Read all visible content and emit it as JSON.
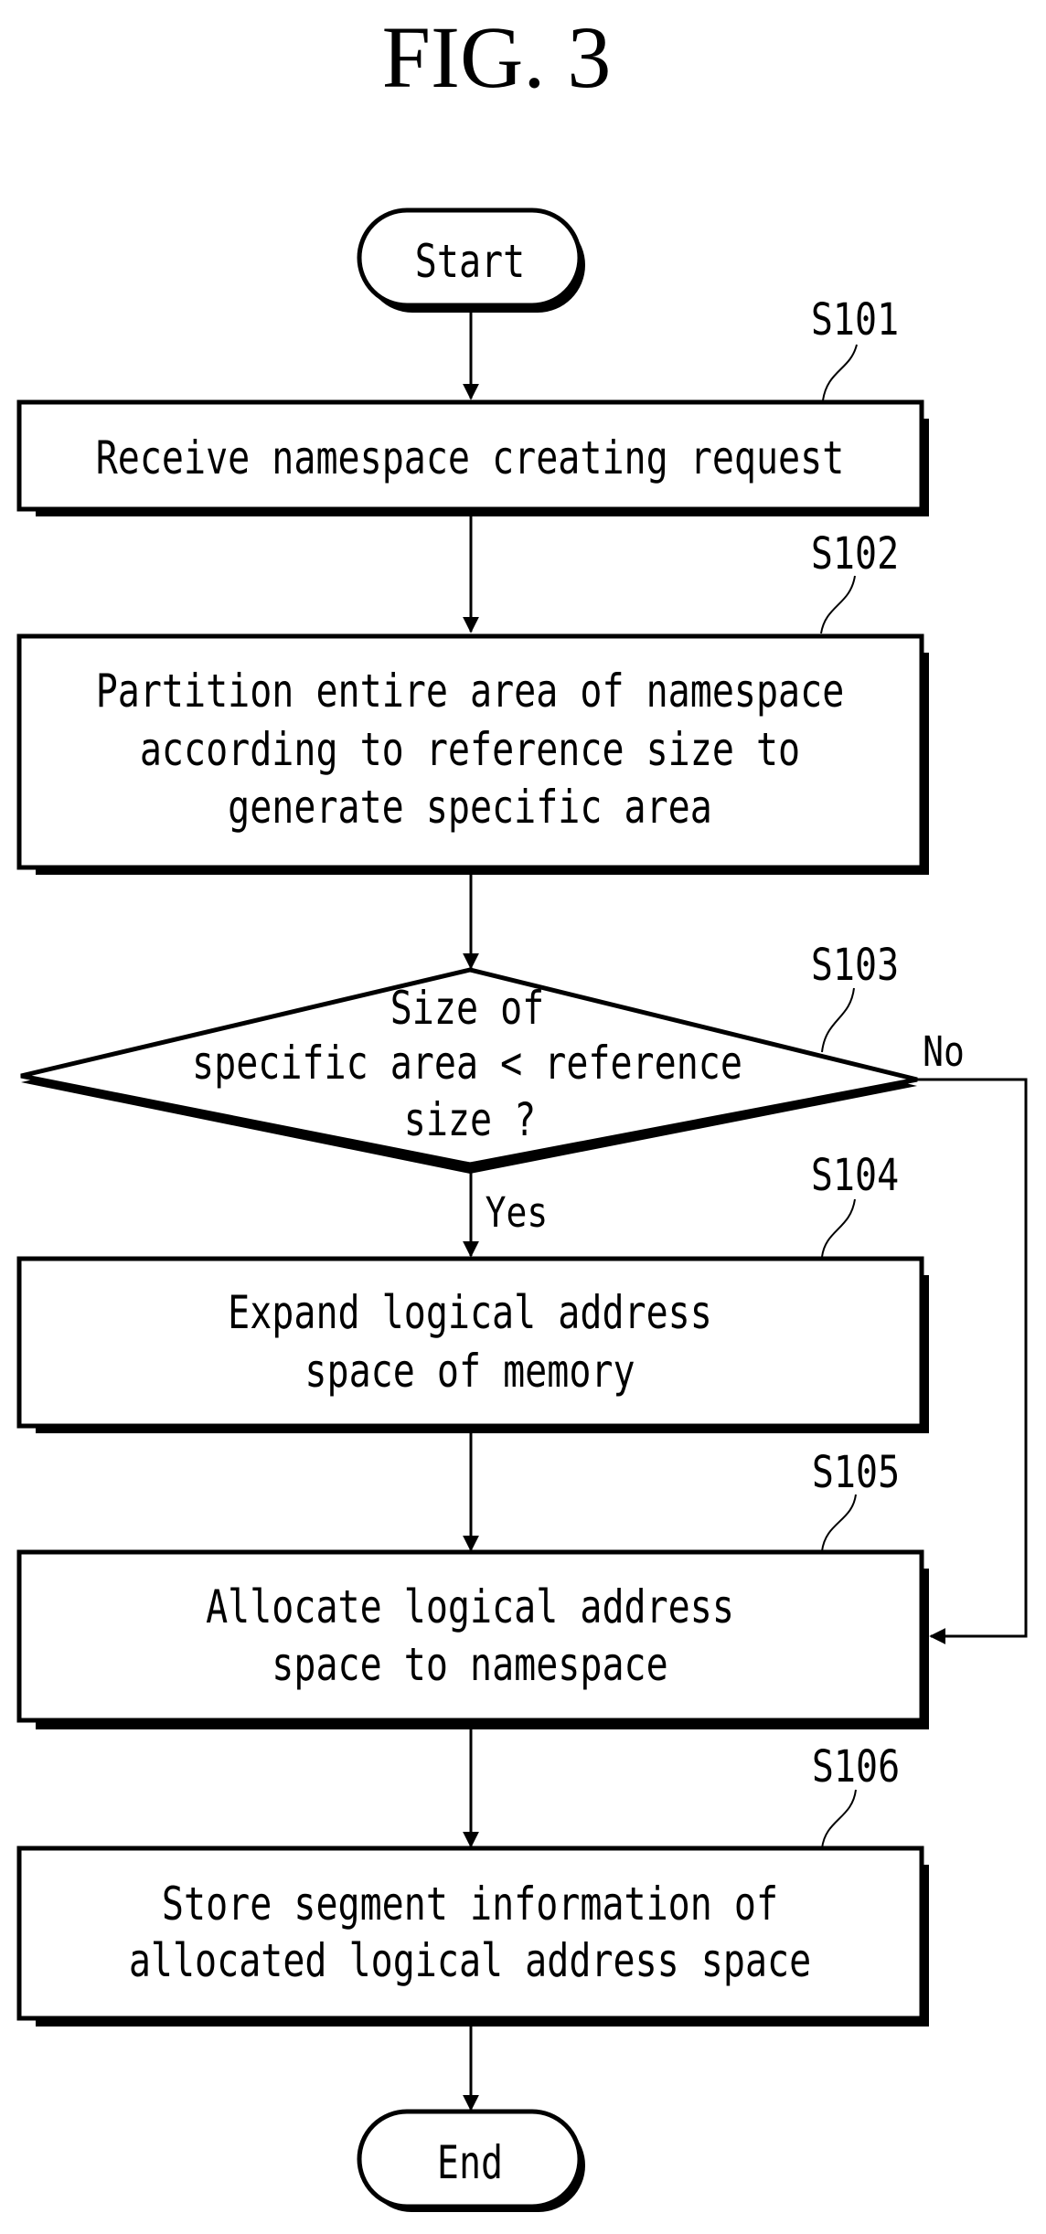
{
  "figure": {
    "title": "FIG. 3"
  },
  "terminals": {
    "start": "Start",
    "end": "End"
  },
  "steps": [
    {
      "ref": "S101",
      "lines": [
        "Receive namespace creating request"
      ]
    },
    {
      "ref": "S102",
      "lines": [
        "Partition entire area of namespace",
        "according to reference size to",
        "generate specific area"
      ]
    },
    {
      "ref": "S104",
      "lines": [
        "Expand logical address",
        "space of memory"
      ]
    },
    {
      "ref": "S105",
      "lines": [
        "Allocate logical address",
        "space to namespace"
      ]
    },
    {
      "ref": "S106",
      "lines": [
        "Store segment information of",
        "allocated logical address space"
      ]
    }
  ],
  "decision": {
    "ref": "S103",
    "lines": [
      "Size of",
      "specific area < reference",
      "size ?"
    ],
    "yes_label": "Yes",
    "no_label": "No"
  }
}
